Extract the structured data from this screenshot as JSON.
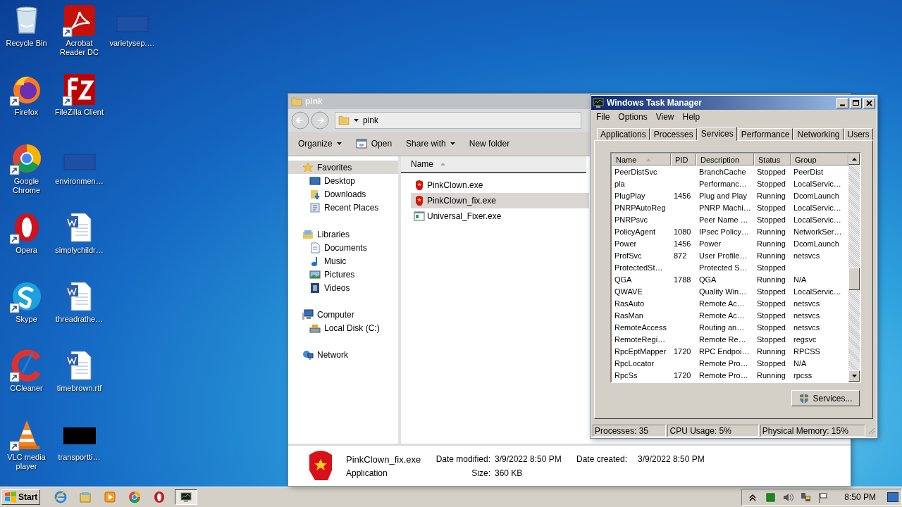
{
  "desktop": {
    "icons": [
      {
        "label": "Recycle Bin",
        "kind": "recycle",
        "shortcut": false
      },
      {
        "label": "Firefox",
        "kind": "firefox",
        "shortcut": true
      },
      {
        "label": "Google Chrome",
        "kind": "chrome",
        "shortcut": true
      },
      {
        "label": "Opera",
        "kind": "opera",
        "shortcut": true
      },
      {
        "label": "Skype",
        "kind": "skype",
        "shortcut": true
      },
      {
        "label": "CCleaner",
        "kind": "ccleaner",
        "shortcut": true
      },
      {
        "label": "VLC media player",
        "kind": "vlc",
        "shortcut": true
      },
      {
        "label": "Acrobat Reader DC",
        "kind": "acrobat",
        "shortcut": true
      },
      {
        "label": "FileZilla Client",
        "kind": "filezilla",
        "shortcut": true
      },
      {
        "label": "environmen…",
        "kind": "blank",
        "shortcut": false
      },
      {
        "label": "simplychildr…",
        "kind": "word",
        "shortcut": false
      },
      {
        "label": "threadrathe…",
        "kind": "word",
        "shortcut": false
      },
      {
        "label": "timebrown.rtf",
        "kind": "word",
        "shortcut": false
      },
      {
        "label": "transportti…",
        "kind": "black",
        "shortcut": false
      },
      {
        "label": "varietysep.…",
        "kind": "blank",
        "shortcut": false
      }
    ]
  },
  "explorer": {
    "title": "pink",
    "address": "pink",
    "toolbar": [
      {
        "label": "Organize",
        "kind": "menu"
      },
      {
        "label": "Open",
        "kind": "open"
      },
      {
        "label": "Share with",
        "kind": "menu"
      },
      {
        "label": "New folder",
        "kind": "plain"
      }
    ],
    "nav": [
      {
        "label": "Favorites",
        "kind": "star",
        "selected": true,
        "children": [
          {
            "label": "Desktop",
            "kind": "desktop"
          },
          {
            "label": "Downloads",
            "kind": "downloads"
          },
          {
            "label": "Recent Places",
            "kind": "recent"
          }
        ]
      },
      {
        "label": "Libraries",
        "kind": "library",
        "selected": false,
        "children": [
          {
            "label": "Documents",
            "kind": "documents"
          },
          {
            "label": "Music",
            "kind": "music"
          },
          {
            "label": "Pictures",
            "kind": "pictures"
          },
          {
            "label": "Videos",
            "kind": "videos"
          }
        ]
      },
      {
        "label": "Computer",
        "kind": "computer",
        "selected": false,
        "children": [
          {
            "label": "Local Disk (C:)",
            "kind": "disk"
          }
        ]
      },
      {
        "label": "Network",
        "kind": "network",
        "selected": false
      }
    ],
    "column": "Name",
    "files": [
      {
        "name": "PinkClown.exe",
        "kind": "clown",
        "selected": false
      },
      {
        "name": "PinkClown_fix.exe",
        "kind": "clown",
        "selected": true
      },
      {
        "name": "Universal_Fixer.exe",
        "kind": "app",
        "selected": false
      }
    ],
    "details": {
      "name": "PinkClown_fix.exe",
      "type": "Application",
      "date_modified_label": "Date modified:",
      "date_modified": "3/9/2022 8:50 PM",
      "size_label": "Size:",
      "size": "360 KB",
      "date_created_label": "Date created:",
      "date_created": "3/9/2022 8:50 PM"
    }
  },
  "task_manager": {
    "title": "Windows Task Manager",
    "menu": [
      "File",
      "Options",
      "View",
      "Help"
    ],
    "tabs": [
      {
        "label": "Applications",
        "selected": false
      },
      {
        "label": "Processes",
        "selected": false
      },
      {
        "label": "Services",
        "selected": true
      },
      {
        "label": "Performance",
        "selected": false
      },
      {
        "label": "Networking",
        "selected": false
      },
      {
        "label": "Users",
        "selected": false
      }
    ],
    "columns": [
      "Name",
      "PID",
      "Description",
      "Status",
      "Group"
    ],
    "rows": [
      [
        "PeerDistSvc",
        "",
        "BranchCache",
        "Stopped",
        "PeerDist"
      ],
      [
        "pla",
        "",
        "Performanc…",
        "Stopped",
        "LocalServic…"
      ],
      [
        "PlugPlay",
        "1456",
        "Plug and Play",
        "Running",
        "DcomLaunch"
      ],
      [
        "PNRPAutoReg",
        "",
        "PNRP Machi…",
        "Stopped",
        "LocalServic…"
      ],
      [
        "PNRPsvc",
        "",
        "Peer Name …",
        "Stopped",
        "LocalServic…"
      ],
      [
        "PolicyAgent",
        "1080",
        "IPsec Policy…",
        "Running",
        "NetworkSer…"
      ],
      [
        "Power",
        "1456",
        "Power",
        "Running",
        "DcomLaunch"
      ],
      [
        "ProfSvc",
        "872",
        "User Profile…",
        "Running",
        "netsvcs"
      ],
      [
        "ProtectedSt…",
        "",
        "Protected S…",
        "Stopped",
        ""
      ],
      [
        "QGA",
        "1788",
        "QGA",
        "Running",
        "N/A"
      ],
      [
        "QWAVE",
        "",
        "Quality Win…",
        "Stopped",
        "LocalServic…"
      ],
      [
        "RasAuto",
        "",
        "Remote Ac…",
        "Stopped",
        "netsvcs"
      ],
      [
        "RasMan",
        "",
        "Remote Ac…",
        "Stopped",
        "netsvcs"
      ],
      [
        "RemoteAccess",
        "",
        "Routing an…",
        "Stopped",
        "netsvcs"
      ],
      [
        "RemoteRegi…",
        "",
        "Remote Re…",
        "Stopped",
        "regsvc"
      ],
      [
        "RpcEptMapper",
        "1720",
        "RPC Endpoi…",
        "Running",
        "RPCSS"
      ],
      [
        "RpcLocator",
        "",
        "Remote Pro…",
        "Stopped",
        "N/A"
      ],
      [
        "RpcSs",
        "1720",
        "Remote Pro…",
        "Running",
        "rpcss"
      ]
    ],
    "services_button": "Services...",
    "status": [
      "Processes: 35",
      "CPU Usage: 5%",
      "Physical Memory: 15%"
    ]
  },
  "taskbar": {
    "start": "Start",
    "items": [
      {
        "kind": "ie",
        "selected": false
      },
      {
        "kind": "explorer",
        "selected": false
      },
      {
        "kind": "media",
        "selected": false
      },
      {
        "kind": "chrome",
        "selected": false
      },
      {
        "kind": "opera",
        "selected": false
      },
      {
        "kind": "taskmgr",
        "selected": true
      }
    ],
    "tray": [
      {
        "kind": "chevron"
      },
      {
        "kind": "green"
      },
      {
        "kind": "speaker"
      },
      {
        "kind": "network"
      },
      {
        "kind": "flag"
      }
    ],
    "clock": "8:50 PM"
  }
}
